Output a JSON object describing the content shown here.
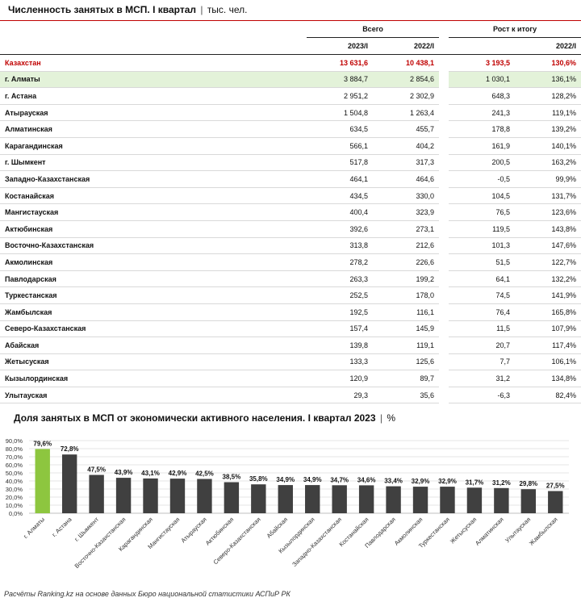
{
  "table": {
    "title": "Численность занятых в МСП. I квартал",
    "unit": "тыс. чел.",
    "group_total": "Всего",
    "group_growth": "Рост к итогу",
    "year_2023": "2023/I",
    "year_2022": "2022/I",
    "year_growth": "2022/I",
    "rows": [
      {
        "name": "Казахстан",
        "v2023": "13 631,6",
        "v2022": "10 438,1",
        "diff": "3 193,5",
        "pct": "130,6%"
      },
      {
        "name": "г. Алматы",
        "v2023": "3 884,7",
        "v2022": "2 854,6",
        "diff": "1 030,1",
        "pct": "136,1%"
      },
      {
        "name": "г. Астана",
        "v2023": "2 951,2",
        "v2022": "2 302,9",
        "diff": "648,3",
        "pct": "128,2%"
      },
      {
        "name": "Атырауская",
        "v2023": "1 504,8",
        "v2022": "1 263,4",
        "diff": "241,3",
        "pct": "119,1%"
      },
      {
        "name": "Алматинская",
        "v2023": "634,5",
        "v2022": "455,7",
        "diff": "178,8",
        "pct": "139,2%"
      },
      {
        "name": "Карагандинская",
        "v2023": "566,1",
        "v2022": "404,2",
        "diff": "161,9",
        "pct": "140,1%"
      },
      {
        "name": "г. Шымкент",
        "v2023": "517,8",
        "v2022": "317,3",
        "diff": "200,5",
        "pct": "163,2%"
      },
      {
        "name": "Западно-Казахстанская",
        "v2023": "464,1",
        "v2022": "464,6",
        "diff": "-0,5",
        "pct": "99,9%"
      },
      {
        "name": "Костанайская",
        "v2023": "434,5",
        "v2022": "330,0",
        "diff": "104,5",
        "pct": "131,7%"
      },
      {
        "name": "Мангистауская",
        "v2023": "400,4",
        "v2022": "323,9",
        "diff": "76,5",
        "pct": "123,6%"
      },
      {
        "name": "Актюбинская",
        "v2023": "392,6",
        "v2022": "273,1",
        "diff": "119,5",
        "pct": "143,8%"
      },
      {
        "name": "Восточно-Казахстанская",
        "v2023": "313,8",
        "v2022": "212,6",
        "diff": "101,3",
        "pct": "147,6%"
      },
      {
        "name": "Акмолинская",
        "v2023": "278,2",
        "v2022": "226,6",
        "diff": "51,5",
        "pct": "122,7%"
      },
      {
        "name": "Павлодарская",
        "v2023": "263,3",
        "v2022": "199,2",
        "diff": "64,1",
        "pct": "132,2%"
      },
      {
        "name": "Туркестанская",
        "v2023": "252,5",
        "v2022": "178,0",
        "diff": "74,5",
        "pct": "141,9%"
      },
      {
        "name": "Жамбылская",
        "v2023": "192,5",
        "v2022": "116,1",
        "diff": "76,4",
        "pct": "165,8%"
      },
      {
        "name": "Северо-Казахстанская",
        "v2023": "157,4",
        "v2022": "145,9",
        "diff": "11,5",
        "pct": "107,9%"
      },
      {
        "name": "Абайская",
        "v2023": "139,8",
        "v2022": "119,1",
        "diff": "20,7",
        "pct": "117,4%"
      },
      {
        "name": "Жетысуская",
        "v2023": "133,3",
        "v2022": "125,6",
        "diff": "7,7",
        "pct": "106,1%"
      },
      {
        "name": "Кызылординская",
        "v2023": "120,9",
        "v2022": "89,7",
        "diff": "31,2",
        "pct": "134,8%"
      },
      {
        "name": "Улытауская",
        "v2023": "29,3",
        "v2022": "35,6",
        "diff": "-6,3",
        "pct": "82,4%"
      }
    ]
  },
  "chart_title": "Доля занятых в МСП от экономически активного населения. I квартал 2023",
  "chart_unit": "%",
  "footer": "Расчёты Ranking.kz на основе данных Бюро национальной статистики АСПиР РК",
  "colors": {
    "accent_red": "#c00000",
    "highlight_row": "#e3f2d9",
    "bar_highlight": "#8dc63f",
    "bar_default": "#404040"
  },
  "chart_data": {
    "type": "bar",
    "title": "Доля занятых в МСП от экономически активного населения. I квартал 2023",
    "ylabel": "%",
    "ylim": [
      0,
      90
    ],
    "yticks": [
      "0,0%",
      "10,0%",
      "20,0%",
      "30,0%",
      "40,0%",
      "50,0%",
      "60,0%",
      "70,0%",
      "80,0%",
      "90,0%"
    ],
    "grid": true,
    "highlight_index": 0,
    "categories": [
      "г. Алматы",
      "г. Астана",
      "г. Шымкент",
      "Восточно-Казахстанская",
      "Карагандинская",
      "Мангистауская",
      "Атырауская",
      "Актюбинская",
      "Северо-Казахстанская",
      "Абайская",
      "Кызылординская",
      "Западно-Казахстанская",
      "Костанайская",
      "Павлодарская",
      "Акмолинская",
      "Туркестанская",
      "Жетысуская",
      "Алматинская",
      "Улытауская",
      "Жамбылская"
    ],
    "values": [
      79.6,
      72.8,
      47.5,
      43.9,
      43.1,
      42.9,
      42.5,
      38.5,
      35.8,
      34.9,
      34.9,
      34.7,
      34.6,
      33.4,
      32.9,
      32.9,
      31.7,
      31.2,
      29.8,
      27.5
    ],
    "labels": [
      "79,6%",
      "72,8%",
      "47,5%",
      "43,9%",
      "43,1%",
      "42,9%",
      "42,5%",
      "38,5%",
      "35,8%",
      "34,9%",
      "34,9%",
      "34,7%",
      "34,6%",
      "33,4%",
      "32,9%",
      "32,9%",
      "31,7%",
      "31,2%",
      "29,8%",
      "27,5%"
    ]
  }
}
